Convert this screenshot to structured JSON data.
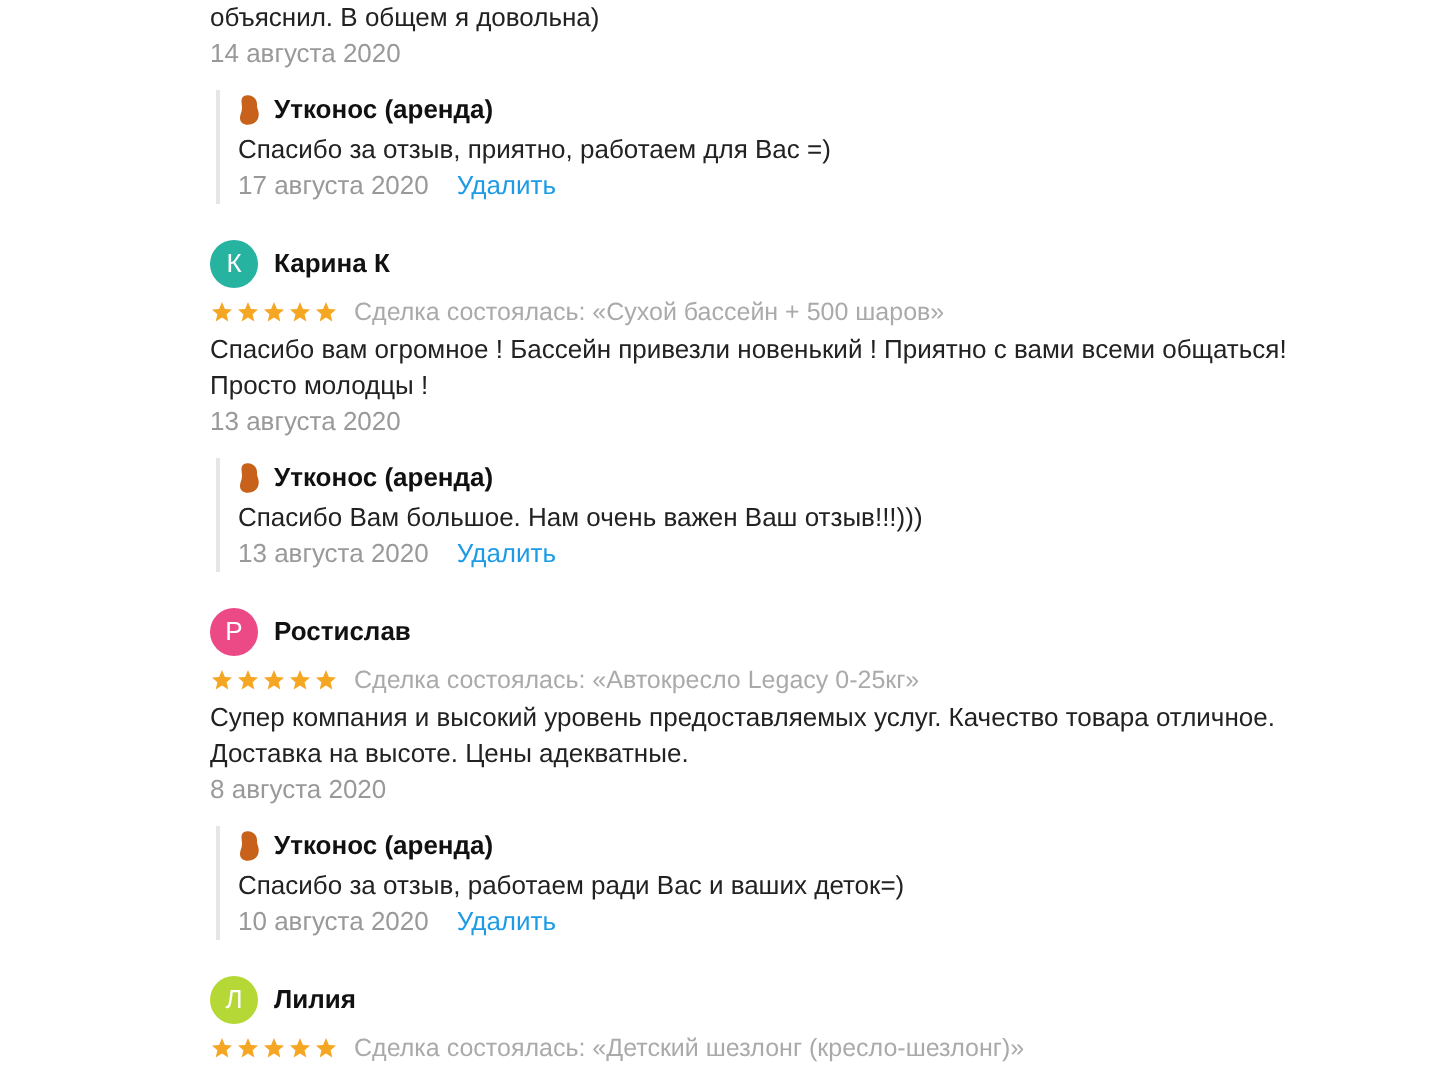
{
  "reviews": [
    {
      "text": "объяснил. В общем я довольна)",
      "date": "14 августа 2020",
      "reply": {
        "author": "Утконос (аренда)",
        "text": "Спасибо за отзыв, приятно, работаем для Вас =)",
        "date": "17 августа 2020",
        "action": "Удалить"
      }
    },
    {
      "initial": "К",
      "color": "#26b3a0",
      "name": "Карина К",
      "stars": 5,
      "deal": "Сделка состоялась: «Сухой бассейн + 500 шаров»",
      "text": "Спасибо вам огромное ! Бассейн привезли новенький ! Приятно с вами всеми общаться! Просто молодцы !",
      "date": "13 августа 2020",
      "reply": {
        "author": "Утконос (аренда)",
        "text": "Спасибо Вам большое. Нам очень важен Ваш отзыв!!!)))",
        "date": "13 августа 2020",
        "action": "Удалить"
      }
    },
    {
      "initial": "Р",
      "color": "#ec4a86",
      "name": "Ростислав",
      "stars": 5,
      "deal": "Сделка состоялась: «Автокресло Legacy 0-25кг»",
      "text": "Супер компания и высокий уровень предоставляемых услуг. Качество товара отличное. Доставка на высоте. Цены адекватные.",
      "date": "8 августа 2020",
      "reply": {
        "author": "Утконос (аренда)",
        "text": "Спасибо за отзыв, работаем ради Вас и ваших деток=)",
        "date": "10 августа 2020",
        "action": "Удалить"
      }
    },
    {
      "initial": "Л",
      "color": "#b5d836",
      "name": "Лилия",
      "stars": 5,
      "deal": "Сделка состоялась: «Детский шезлонг (кресло-шезлонг)»"
    }
  ]
}
